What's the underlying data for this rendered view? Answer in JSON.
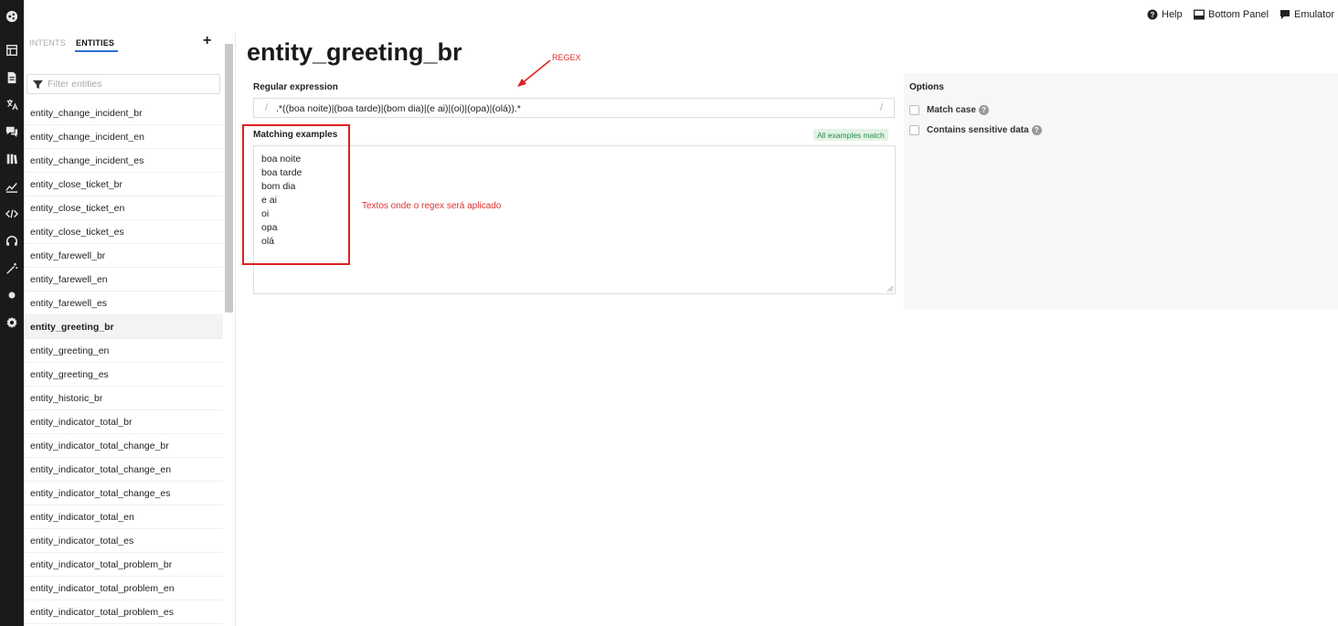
{
  "rail": {
    "icons": [
      "logo-icon",
      "layout-icon",
      "document-icon",
      "translate-icon",
      "chat-icon",
      "library-icon",
      "analytics-icon",
      "code-icon",
      "headset-icon",
      "wand-icon",
      "dot-icon",
      "settings-icon"
    ]
  },
  "topbar": {
    "help_label": "Help",
    "bottom_panel_label": "Bottom Panel",
    "emulator_label": "Emulator"
  },
  "panel": {
    "tab_intents": "INTENTS",
    "tab_entities": "ENTITIES",
    "add_label": "+",
    "filter_placeholder": "Filter entities",
    "items": [
      "entity_change_incident_br",
      "entity_change_incident_en",
      "entity_change_incident_es",
      "entity_close_ticket_br",
      "entity_close_ticket_en",
      "entity_close_ticket_es",
      "entity_farewell_br",
      "entity_farewell_en",
      "entity_farewell_es",
      "entity_greeting_br",
      "entity_greeting_en",
      "entity_greeting_es",
      "entity_historic_br",
      "entity_indicator_total_br",
      "entity_indicator_total_change_br",
      "entity_indicator_total_change_en",
      "entity_indicator_total_change_es",
      "entity_indicator_total_en",
      "entity_indicator_total_es",
      "entity_indicator_total_problem_br",
      "entity_indicator_total_problem_en",
      "entity_indicator_total_problem_es"
    ],
    "active_item": "entity_greeting_br"
  },
  "main": {
    "title": "entity_greeting_br",
    "annotation_regex": "REGEX",
    "regex_label": "Regular expression",
    "regex_value": ".*((boa noite)|(boa tarde)|(bom dia)|(e ai)|(oi)|(opa)|(olá)).*",
    "matching_label": "Matching examples",
    "match_badge": "All examples match",
    "examples": [
      "boa noite",
      "boa tarde",
      "bom dia",
      "e ai",
      "oi",
      "opa",
      "olá"
    ],
    "annotation_textos": "Textos onde o regex será aplicado",
    "annotation_color": "#e02020"
  },
  "options": {
    "title": "Options",
    "match_case_label": "Match case",
    "sensitive_label": "Contains sensitive data",
    "help_glyph": "?"
  }
}
